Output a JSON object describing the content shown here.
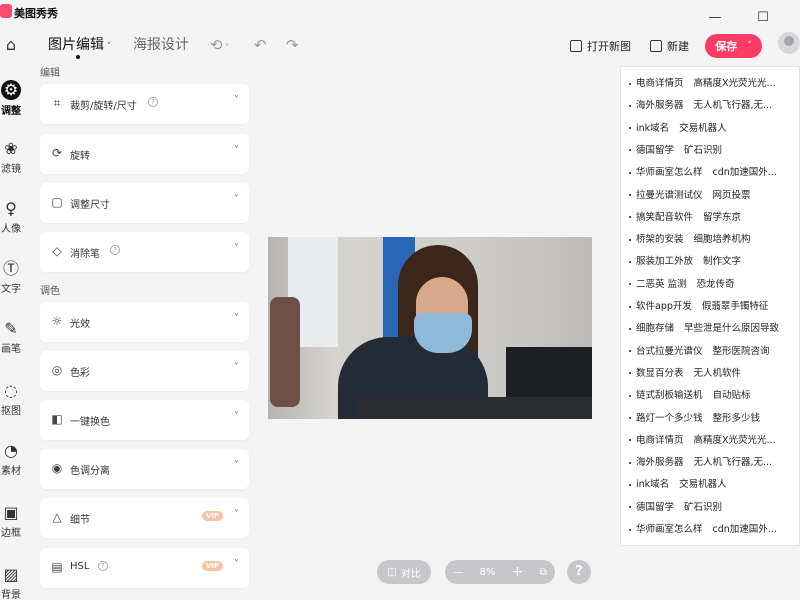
{
  "app": {
    "title": "美图秀秀"
  },
  "window": {
    "minimize": "—",
    "maximize": "☐",
    "close": "✕"
  },
  "toolbar": {
    "tabs": [
      {
        "label": "图片编辑",
        "active": true
      },
      {
        "label": "海报设计",
        "active": false
      }
    ],
    "open_new_image": "打开新图",
    "new": "新建",
    "save": "保存"
  },
  "rail": {
    "items": [
      {
        "label": "",
        "icon": "home-icon",
        "glyph": "⌂"
      },
      {
        "label": "调整",
        "icon": "adjust-icon",
        "glyph": "⚙",
        "active": true
      },
      {
        "label": "滤镜",
        "icon": "filter-icon",
        "glyph": "❀"
      },
      {
        "label": "人像",
        "icon": "portrait-icon",
        "glyph": "♀"
      },
      {
        "label": "文字",
        "icon": "text-icon",
        "glyph": "Ⓣ"
      },
      {
        "label": "画笔",
        "icon": "brush-icon",
        "glyph": "✎"
      },
      {
        "label": "抠图",
        "icon": "cutout-icon",
        "glyph": "◌"
      },
      {
        "label": "素材",
        "icon": "sticker-icon",
        "glyph": "◔"
      },
      {
        "label": "边框",
        "icon": "frame-icon",
        "glyph": "▣"
      },
      {
        "label": "背景",
        "icon": "background-icon",
        "glyph": "▨"
      }
    ]
  },
  "panel": {
    "section_edit": "编辑",
    "section_color": "调色",
    "edit_items": [
      {
        "label": "裁剪/旋转/尺寸",
        "icon": "crop-icon",
        "glyph": "⌗",
        "help": true
      },
      {
        "label": "旋转",
        "icon": "rotate-icon",
        "glyph": "⟳"
      },
      {
        "label": "调整尺寸",
        "icon": "resize-icon",
        "glyph": "▢"
      },
      {
        "label": "消除笔",
        "icon": "eraser-icon",
        "glyph": "◇",
        "help": true
      }
    ],
    "color_items": [
      {
        "label": "光效",
        "icon": "light-icon",
        "glyph": "☼"
      },
      {
        "label": "色彩",
        "icon": "palette-icon",
        "glyph": "◎"
      },
      {
        "label": "一键换色",
        "icon": "color-swap-icon",
        "glyph": "◧"
      },
      {
        "label": "色调分离",
        "icon": "tone-split-icon",
        "glyph": "◉"
      },
      {
        "label": "细节",
        "icon": "detail-icon",
        "glyph": "△",
        "vip": "VIP"
      },
      {
        "label": "HSL",
        "icon": "hsl-icon",
        "glyph": "▤",
        "help": true,
        "vip": "VIP"
      }
    ]
  },
  "canvas": {
    "compare": "对比",
    "zoom": "8%",
    "zoom_out": "—",
    "zoom_in": "+",
    "help": "?"
  },
  "suggestions": [
    [
      "电商详情页",
      "高精度X光荧光光..."
    ],
    [
      "海外服务器",
      "无人机飞行器,无..."
    ],
    [
      "ink域名",
      "交易机器人"
    ],
    [
      "德国留学",
      "矿石识别"
    ],
    [
      "华师画室怎么样",
      "cdn加速国外..."
    ],
    [
      "拉曼光谱测试仪",
      "网页投票"
    ],
    [
      "搞笑配音软件",
      "留学东京"
    ],
    [
      "桥架的安装",
      "细胞培养机构"
    ],
    [
      "服装加工外放",
      "制作文字"
    ],
    [
      "二恶英 监测",
      "恐龙传奇"
    ],
    [
      "软件app开发",
      "假翡翠手镯特征"
    ],
    [
      "细胞存储",
      "早些泄是什么原因导致"
    ],
    [
      "台式拉曼光谱仪",
      "整形医院咨询"
    ],
    [
      "数显百分表",
      "无人机软件"
    ],
    [
      "链式刮板输送机",
      "自动贴标"
    ],
    [
      "路灯一个多少钱",
      "整形多少钱"
    ],
    [
      "电商详情页",
      "高精度X光荧光光..."
    ],
    [
      "海外服务器",
      "无人机飞行器,无..."
    ],
    [
      "ink域名",
      "交易机器人"
    ],
    [
      "德国留学",
      "矿石识别"
    ],
    [
      "华师画室怎么样",
      "cdn加速国外..."
    ]
  ],
  "colors": {
    "accent": "#ff3a64",
    "active_rail": "#111111",
    "vip": "#f6c4a4"
  }
}
